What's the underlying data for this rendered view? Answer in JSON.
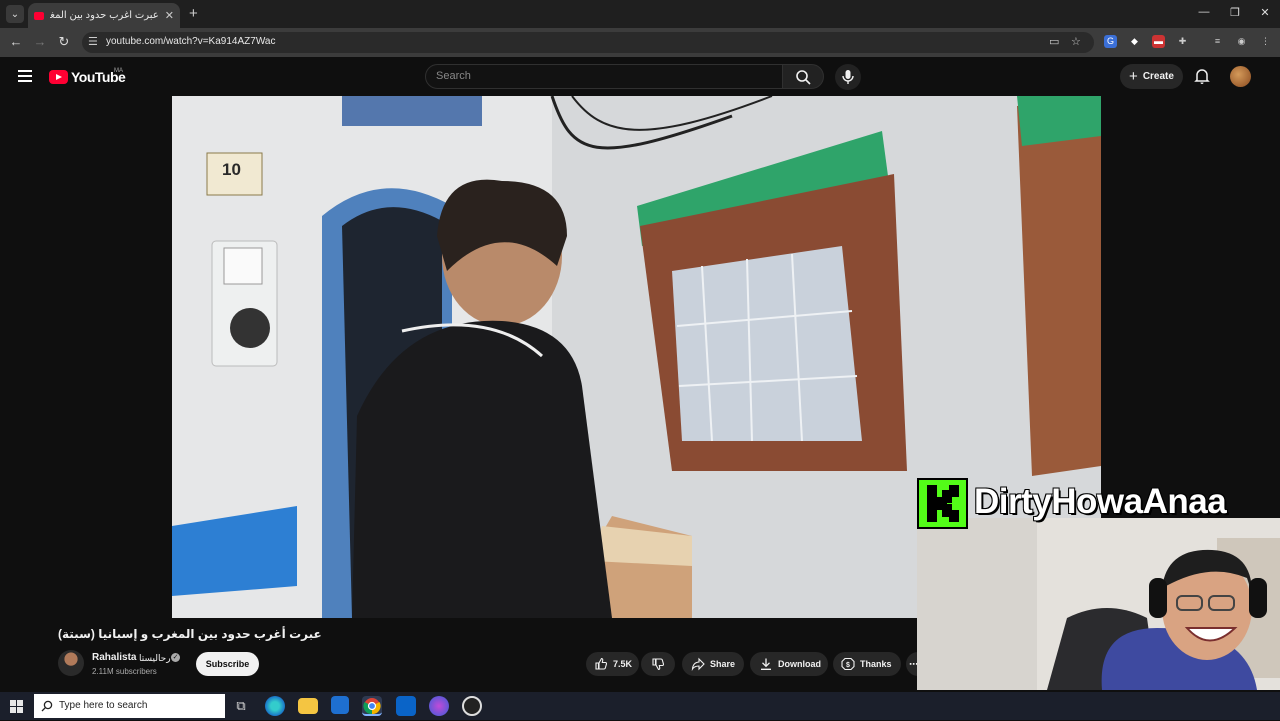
{
  "browser": {
    "tab_title": "عبرت أغرب حدود بين المغرب و إسبانيا (سبتة)",
    "tab_close": "✕",
    "new_tab": "+",
    "url": "youtube.com/watch?v=Ka914AZ7Wac",
    "window_controls": [
      "—",
      "❐",
      "✕"
    ]
  },
  "youtube": {
    "logo_text": "YouTube",
    "country_code": "MA",
    "search_placeholder": "Search",
    "create_label": "Create"
  },
  "video": {
    "house_number": "10",
    "title": "عبرت أغرب حدود بين المغرب و إسبانيا (سبتة)"
  },
  "channel": {
    "name": "Rahalista",
    "name_ar": "رحاليستا",
    "subscribers": "2.11M subscribers",
    "subscribe_label": "Subscribe"
  },
  "actions": {
    "like_count": "7.5K",
    "share_label": "Share",
    "download_label": "Download",
    "thanks_label": "Thanks"
  },
  "overlay": {
    "streamer_name": "DirtyHowaAnaa",
    "logo_letter": "K"
  },
  "taskbar": {
    "search_placeholder": "Type here to search"
  },
  "colors": {
    "youtube_red": "#ff0033",
    "kick_green": "#53fc18",
    "background": "#0f0f0f"
  }
}
